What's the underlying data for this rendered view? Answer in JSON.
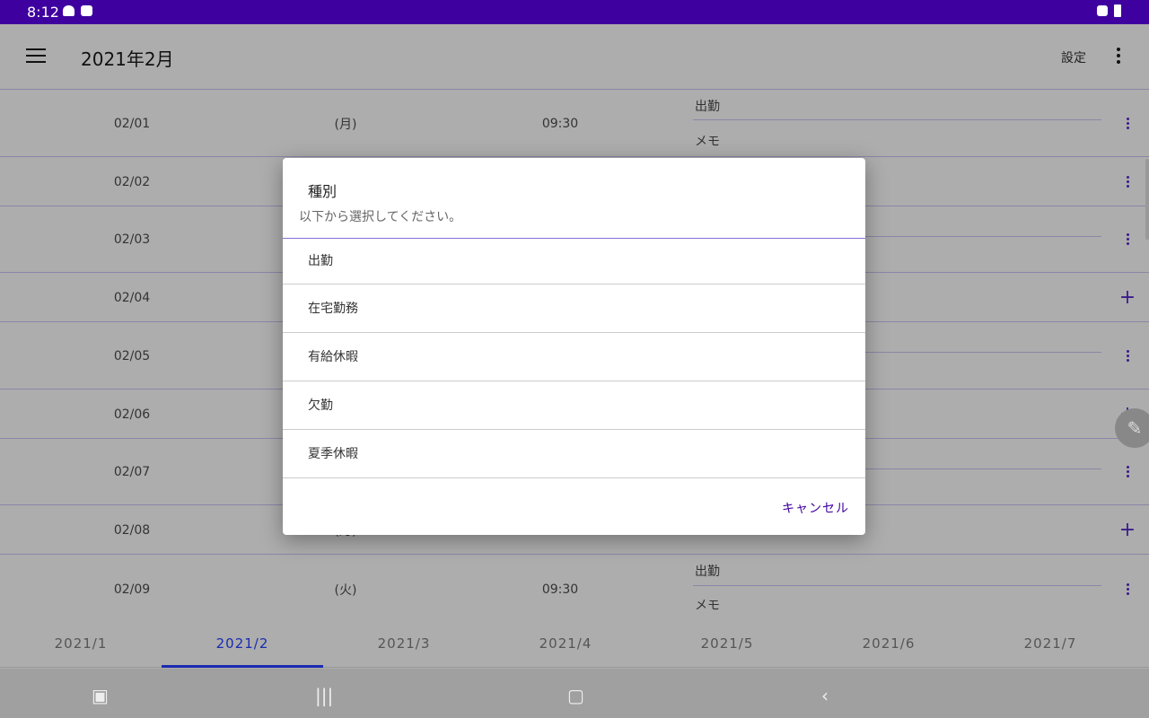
{
  "status_bar": {
    "time": "8:12"
  },
  "app_bar": {
    "title": "2021年2月",
    "settings_label": "設定"
  },
  "rows": [
    {
      "date": "02/01",
      "day": "(月)",
      "time": "09:30",
      "type": "出勤",
      "memo": "メモ",
      "action": "more"
    },
    {
      "date": "02/02",
      "day": "",
      "time": "",
      "type": "",
      "memo": "",
      "action": "more"
    },
    {
      "date": "02/03",
      "day": "",
      "time": "",
      "type": "",
      "memo": "",
      "action": "more"
    },
    {
      "date": "02/04",
      "day": "",
      "time": "",
      "type": "",
      "memo": "",
      "action": "add"
    },
    {
      "date": "02/05",
      "day": "",
      "time": "",
      "type": "",
      "memo": "",
      "action": "more"
    },
    {
      "date": "02/06",
      "day": "",
      "time": "",
      "type": "",
      "memo": "",
      "action": "add"
    },
    {
      "date": "02/07",
      "day": "",
      "time": "",
      "type": "",
      "memo": "",
      "action": "more"
    },
    {
      "date": "02/08",
      "day": "(月)",
      "time": "",
      "type": "",
      "memo": "",
      "action": "add"
    },
    {
      "date": "02/09",
      "day": "(火)",
      "time": "09:30",
      "type": "出勤",
      "memo": "メモ",
      "action": "more"
    }
  ],
  "tabs": [
    "2021/1",
    "2021/2",
    "2021/3",
    "2021/4",
    "2021/5",
    "2021/6",
    "2021/7"
  ],
  "selected_tab": "2021/2",
  "dialog": {
    "title": "種別",
    "subtitle": "以下から選択してください。",
    "options": [
      "出勤",
      "在宅勤務",
      "有給休暇",
      "欠勤",
      "夏季休暇"
    ],
    "cancel_label": "キャンセル"
  },
  "colors": {
    "accent": "#3f00a0",
    "tab_indicator": "#1a2bb0"
  }
}
